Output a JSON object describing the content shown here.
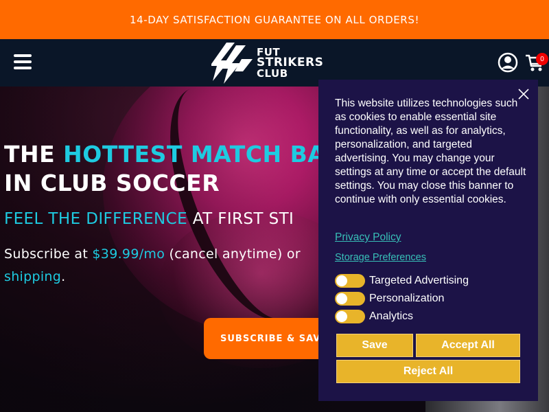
{
  "announcement": "14-DAY SATISFACTION GUARANTEE ON ALL ORDERS!",
  "header": {
    "logo_lines": [
      "FUT",
      "STRIKERS",
      "CLUB"
    ],
    "cart_count": "0",
    "icons": [
      "hamburger-menu-icon",
      "account-icon",
      "cart-icon"
    ]
  },
  "hero": {
    "headline_pre": "THE ",
    "headline_highlight": "HOTTEST MATCH BA",
    "headline_line2": "IN CLUB SOCCER",
    "subhead_highlight": "FEEL THE DIFFERENCE",
    "subhead_rest": " AT FIRST STI",
    "body_pre": "Subscribe at ",
    "body_price": "$39.99/mo",
    "body_mid": " (cancel anytime) or",
    "body_line2": "shipping",
    "body_end": ".",
    "cta_label": "SUBSCRIBE & SAV"
  },
  "cookie_banner": {
    "text": "This website utilizes technologies such as cookies to enable essential site functionality, as well as for analytics, personalization, and targeted advertising. You may change your settings at any time or accept the default settings. You may close this banner to continue with only essential cookies.",
    "privacy_link": "Privacy Policy",
    "storage_link": "Storage Preferences",
    "toggles": [
      {
        "label": "Targeted Advertising",
        "on": false
      },
      {
        "label": "Personalization",
        "on": false
      },
      {
        "label": "Analytics",
        "on": false
      }
    ],
    "save_label": "Save",
    "accept_label": "Accept All",
    "reject_label": "Reject All",
    "accent_color": "#e8b42a",
    "background_color": "#1c1347"
  },
  "colors": {
    "announcement_bg": "#ff6a00",
    "header_bg": "#0a1628",
    "highlight": "#1ecbe1",
    "cta_bg": "#ff6a00"
  }
}
